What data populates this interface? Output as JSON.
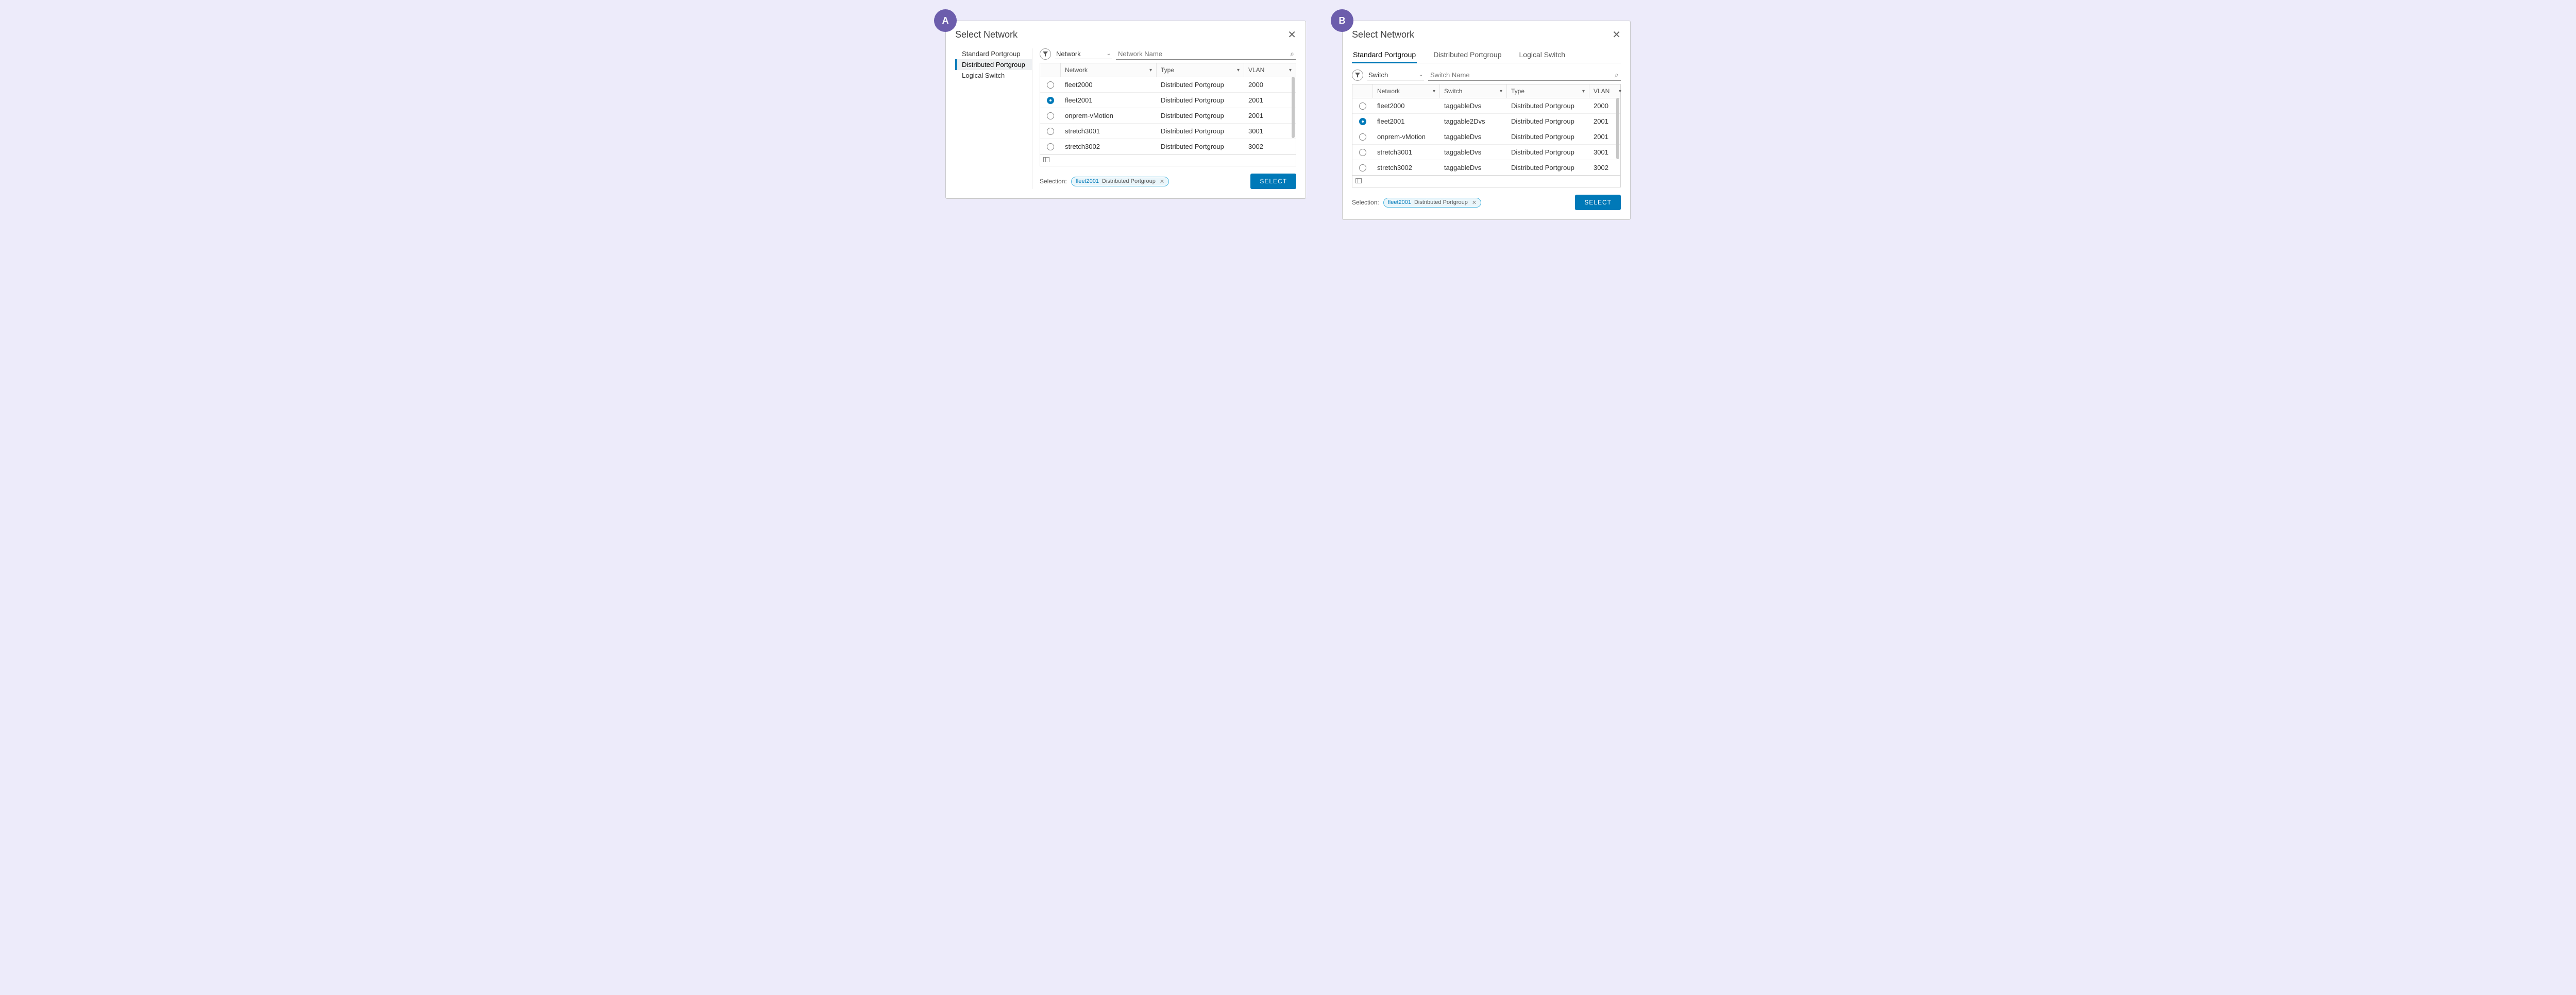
{
  "dialog_title": "Select Network",
  "select_button": "SELECT",
  "selection_label": "Selection:",
  "panels": [
    {
      "badge": "A",
      "sidebar": [
        {
          "label": "Standard Portgroup",
          "active": false
        },
        {
          "label": "Distributed Portgroup",
          "active": true
        },
        {
          "label": "Logical Switch",
          "active": false
        }
      ],
      "filter_select": "Network",
      "search_placeholder": "Network Name",
      "columns": [
        "Network",
        "Type",
        "VLAN"
      ],
      "rows": [
        {
          "selected": false,
          "network": "fleet2000",
          "type": "Distributed Portgroup",
          "vlan": "2000"
        },
        {
          "selected": true,
          "network": "fleet2001",
          "type": "Distributed Portgroup",
          "vlan": "2001"
        },
        {
          "selected": false,
          "network": "onprem-vMotion",
          "type": "Distributed Portgroup",
          "vlan": "2001"
        },
        {
          "selected": false,
          "network": "stretch3001",
          "type": "Distributed Portgroup",
          "vlan": "3001"
        },
        {
          "selected": false,
          "network": "stretch3002",
          "type": "Distributed Portgroup",
          "vlan": "3002"
        }
      ],
      "selection_pill": {
        "primary": "fleet2001",
        "secondary": "Distributed Portgroup"
      }
    },
    {
      "badge": "B",
      "tabs": [
        {
          "label": "Standard Portgroup",
          "active": true
        },
        {
          "label": "Distributed Portgroup",
          "active": false
        },
        {
          "label": "Logical Switch",
          "active": false
        }
      ],
      "filter_select": "Switch",
      "search_placeholder": "Switch Name",
      "columns": [
        "Network",
        "Switch",
        "Type",
        "VLAN"
      ],
      "rows": [
        {
          "selected": false,
          "network": "fleet2000",
          "switch": "taggableDvs",
          "type": "Distributed Portgroup",
          "vlan": "2000"
        },
        {
          "selected": true,
          "network": "fleet2001",
          "switch": "taggable2Dvs",
          "type": "Distributed Portgroup",
          "vlan": "2001"
        },
        {
          "selected": false,
          "network": "onprem-vMotion",
          "switch": "taggableDvs",
          "type": "Distributed Portgroup",
          "vlan": "2001"
        },
        {
          "selected": false,
          "network": "stretch3001",
          "switch": "taggableDvs",
          "type": "Distributed Portgroup",
          "vlan": "3001"
        },
        {
          "selected": false,
          "network": "stretch3002",
          "switch": "taggableDvs",
          "type": "Distributed Portgroup",
          "vlan": "3002"
        }
      ],
      "selection_pill": {
        "primary": "fleet2001",
        "secondary": "Distributed Portgroup"
      }
    }
  ]
}
